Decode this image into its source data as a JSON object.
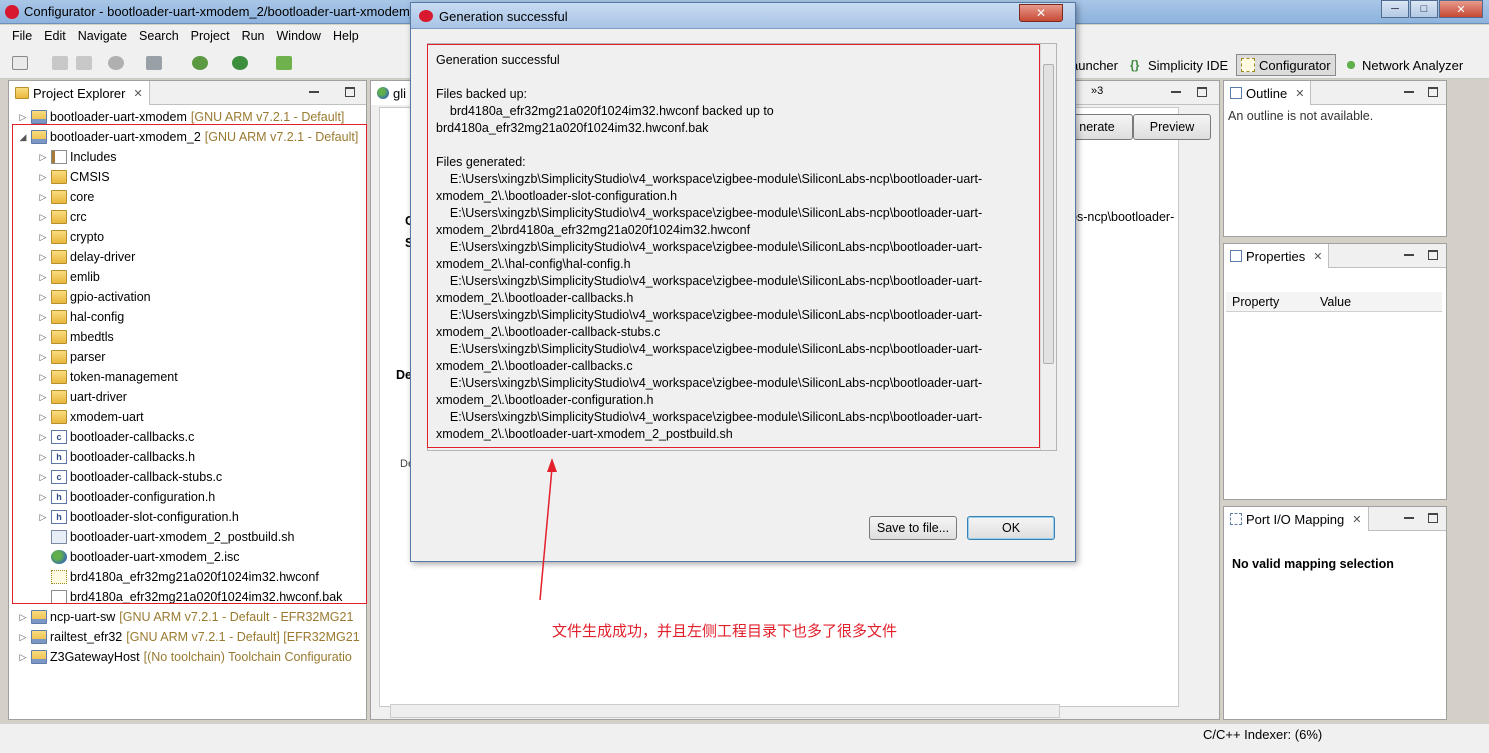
{
  "window": {
    "title": "Configurator - bootloader-uart-xmodem_2/bootloader-uart-xmodem_2.isc"
  },
  "menu": [
    "File",
    "Edit",
    "Navigate",
    "Search",
    "Project",
    "Run",
    "Window",
    "Help"
  ],
  "perspectives": {
    "launcher": "Launcher",
    "ide": "Simplicity IDE",
    "configurator": "Configurator",
    "network": "Network Analyzer"
  },
  "project_explorer": {
    "title": "Project Explorer",
    "items": [
      {
        "label": "bootloader-uart-xmodem",
        "suffix": "[GNU ARM v7.2.1 - Default]"
      },
      {
        "label": "bootloader-uart-xmodem_2",
        "suffix": "[GNU ARM v7.2.1 - Default]"
      },
      {
        "label": "Includes"
      },
      {
        "label": "CMSIS"
      },
      {
        "label": "core"
      },
      {
        "label": "crc"
      },
      {
        "label": "crypto"
      },
      {
        "label": "delay-driver"
      },
      {
        "label": "emlib"
      },
      {
        "label": "gpio-activation"
      },
      {
        "label": "hal-config"
      },
      {
        "label": "mbedtls"
      },
      {
        "label": "parser"
      },
      {
        "label": "token-management"
      },
      {
        "label": "uart-driver"
      },
      {
        "label": "xmodem-uart"
      },
      {
        "label": "bootloader-callbacks.c"
      },
      {
        "label": "bootloader-callbacks.h"
      },
      {
        "label": "bootloader-callback-stubs.c"
      },
      {
        "label": "bootloader-configuration.h"
      },
      {
        "label": "bootloader-slot-configuration.h"
      },
      {
        "label": "bootloader-uart-xmodem_2_postbuild.sh"
      },
      {
        "label": "bootloader-uart-xmodem_2.isc"
      },
      {
        "label": "brd4180a_efr32mg21a020f1024im32.hwconf"
      },
      {
        "label": "brd4180a_efr32mg21a020f1024im32.hwconf.bak"
      },
      {
        "label": "ncp-uart-sw",
        "suffix": "[GNU ARM v7.2.1 - Default - EFR32MG21"
      },
      {
        "label": "railtest_efr32",
        "suffix": "[GNU ARM v7.2.1 - Default] [EFR32MG21"
      },
      {
        "label": "Z3GatewayHost",
        "suffix": "[(No toolchain) Toolchain Configuratio"
      }
    ]
  },
  "editor": {
    "tab_partial": "gli",
    "generate_partial": "nerate",
    "preview": "Preview",
    "path_partial": "bs-ncp\\bootloader-",
    "gen_label": "Ge",
    "s_label": "S",
    "de_label": "De",
    "de2_label": "De",
    "overflow": "»3"
  },
  "outline": {
    "title": "Outline",
    "message": "An outline is not available."
  },
  "properties": {
    "title": "Properties",
    "col_property": "Property",
    "col_value": "Value"
  },
  "port_io": {
    "title": "Port I/O Mapping",
    "message": "No valid mapping selection"
  },
  "dialog": {
    "title": "Generation successful",
    "content": "Generation successful\n\nFiles backed up:\n    brd4180a_efr32mg21a020f1024im32.hwconf backed up to\nbrd4180a_efr32mg21a020f1024im32.hwconf.bak\n\nFiles generated:\n    E:\\Users\\xingzb\\SimplicityStudio\\v4_workspace\\zigbee-module\\SiliconLabs-ncp\\bootloader-uart-\nxmodem_2\\.\\bootloader-slot-configuration.h\n    E:\\Users\\xingzb\\SimplicityStudio\\v4_workspace\\zigbee-module\\SiliconLabs-ncp\\bootloader-uart-\nxmodem_2\\brd4180a_efr32mg21a020f1024im32.hwconf\n    E:\\Users\\xingzb\\SimplicityStudio\\v4_workspace\\zigbee-module\\SiliconLabs-ncp\\bootloader-uart-\nxmodem_2\\.\\hal-config\\hal-config.h\n    E:\\Users\\xingzb\\SimplicityStudio\\v4_workspace\\zigbee-module\\SiliconLabs-ncp\\bootloader-uart-\nxmodem_2\\.\\bootloader-callbacks.h\n    E:\\Users\\xingzb\\SimplicityStudio\\v4_workspace\\zigbee-module\\SiliconLabs-ncp\\bootloader-uart-\nxmodem_2\\.\\bootloader-callback-stubs.c\n    E:\\Users\\xingzb\\SimplicityStudio\\v4_workspace\\zigbee-module\\SiliconLabs-ncp\\bootloader-uart-\nxmodem_2\\.\\bootloader-callbacks.c\n    E:\\Users\\xingzb\\SimplicityStudio\\v4_workspace\\zigbee-module\\SiliconLabs-ncp\\bootloader-uart-\nxmodem_2\\.\\bootloader-configuration.h\n    E:\\Users\\xingzb\\SimplicityStudio\\v4_workspace\\zigbee-module\\SiliconLabs-ncp\\bootloader-uart-\nxmodem_2\\.\\bootloader-uart-xmodem_2_postbuild.sh",
    "save_button": "Save to file...",
    "ok_button": "OK"
  },
  "annotation": "文件生成成功，并且左侧工程目录下也多了很多文件",
  "status": {
    "indexer": "C/C++ Indexer: (6%)"
  },
  "colors": {
    "highlight_red": "#e2202c",
    "dim_text": "#9a7a30"
  }
}
